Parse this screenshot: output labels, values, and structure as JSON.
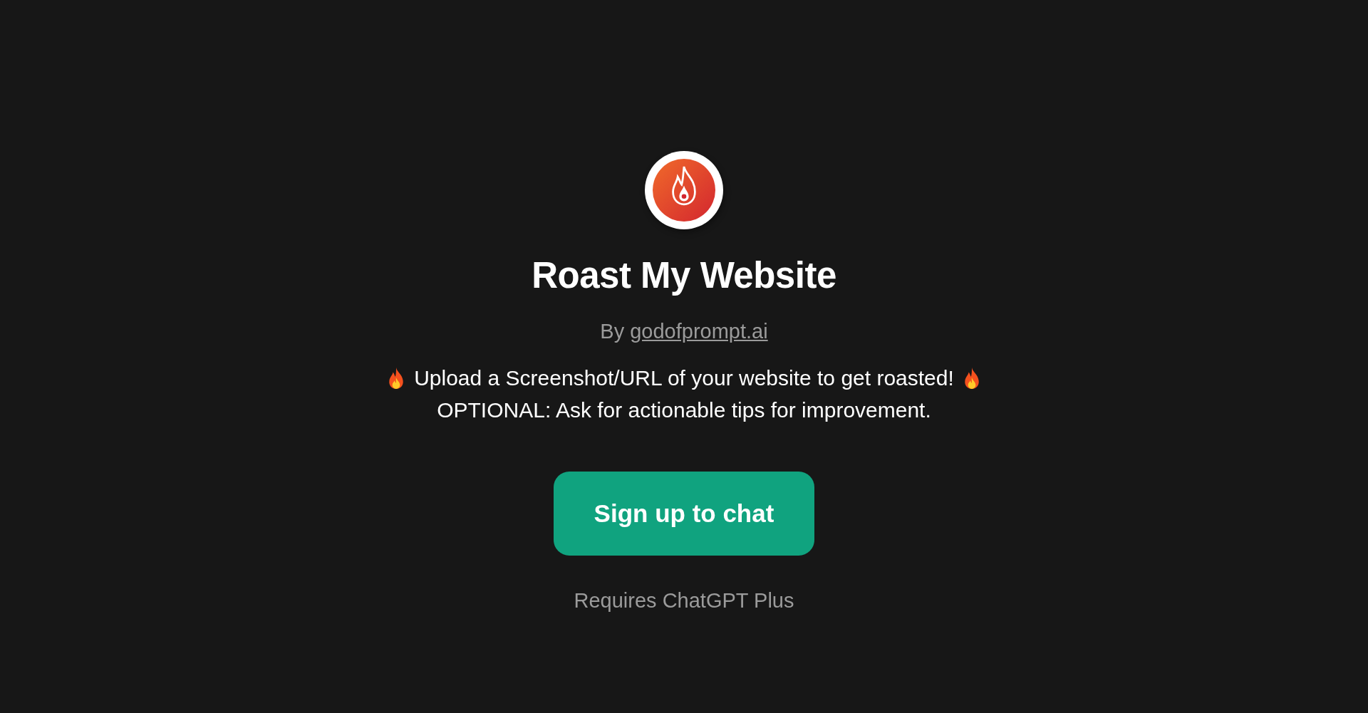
{
  "title": "Roast My Website",
  "author": {
    "prefix": "By",
    "link": "godofprompt.ai"
  },
  "description": [
    {
      "text": "Upload a Screenshot/URL of your website to get roasted!",
      "fire_icons": true
    },
    {
      "text": "OPTIONAL: Ask for actionable tips for improvement.",
      "fire_icons": false
    }
  ],
  "button": "Sign up to chat",
  "note": "Requires ChatGPT Plus"
}
